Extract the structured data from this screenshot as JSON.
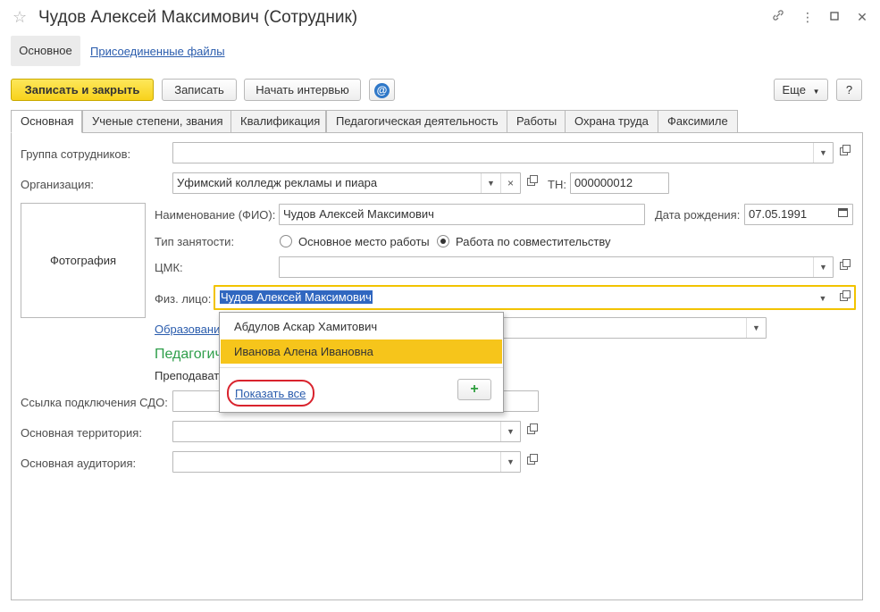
{
  "window": {
    "title": "Чудов Алексей Максимович (Сотрудник)"
  },
  "nav": {
    "main": "Основное",
    "files": "Присоединенные файлы"
  },
  "toolbar": {
    "save_close": "Записать и закрыть",
    "save": "Записать",
    "interview": "Начать интервью",
    "more": "Еще",
    "help": "?"
  },
  "tabs": [
    {
      "label": "Основная"
    },
    {
      "label": "Ученые степени, звания"
    },
    {
      "label": "Квалификация"
    },
    {
      "label": "Педагогическая деятельность"
    },
    {
      "label": "Работы"
    },
    {
      "label": "Охрана труда"
    },
    {
      "label": "Факсимиле"
    }
  ],
  "form": {
    "group_label": "Группа сотрудников:",
    "group_value": "",
    "org_label": "Организация:",
    "org_value": "Уфимский колледж рекламы и пиара",
    "tn_label": "ТН:",
    "tn_value": "000000012",
    "photo": "Фотография",
    "fio_label": "Наименование (ФИО):",
    "fio_value": "Чудов Алексей Максимович",
    "birth_label": "Дата рождения:",
    "birth_value": "07.05.1991",
    "employment_label": "Тип занятости:",
    "employment_opt1": "Основное место работы",
    "employment_opt2": "Работа по совместительству",
    "cmk_label": "ЦМК:",
    "cmk_value": "",
    "person_label": "Физ. лицо:",
    "person_value": "Чудов Алексей Максимович",
    "education_link": "Образовани",
    "ped_heading": "Педагогич",
    "teacher": "Преподават",
    "sdo_label": "Ссылка подключения СДО:",
    "territory_label": "Основная территория:",
    "auditory_label": "Основная аудитория:"
  },
  "popup": {
    "items": [
      {
        "label": "Абдулов Аскар Хамитович"
      },
      {
        "label": "Иванова Алена Ивановна"
      }
    ],
    "show_all": "Показать все",
    "add": "+"
  }
}
